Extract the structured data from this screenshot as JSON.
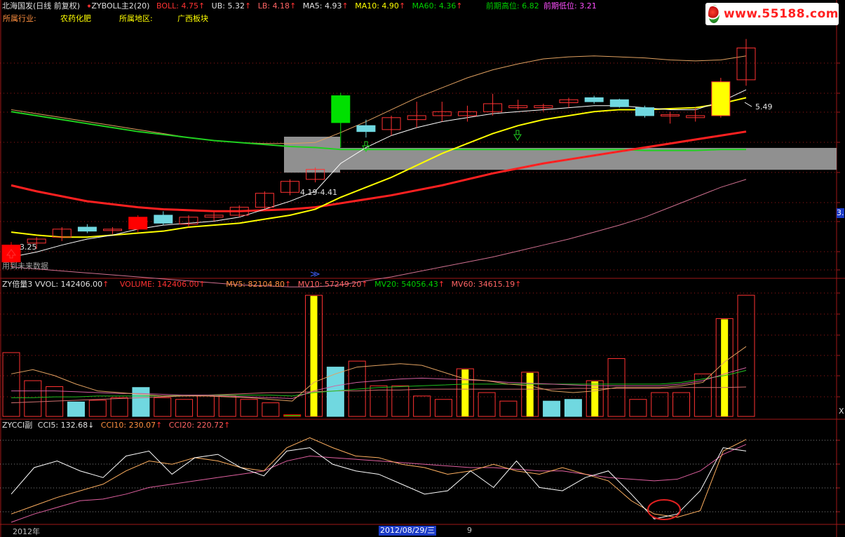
{
  "header": {
    "stock_name": "北海国发(日线 前复权)",
    "indicator": "ZYBOLL主2(20)",
    "boll": "BOLL: 4.75",
    "ub": "UB: 5.32",
    "lb": "LB: 4.18",
    "ma5": "MA5: 4.93",
    "ma10": "MA10: 4.90",
    "ma60": "MA60: 4.36",
    "prev_high": "前期高位: 6.82",
    "prev_low": "前期低位: 3.21",
    "industry_label": "所属行业:",
    "industry_value": "农药化肥",
    "region_label": "所属地区:",
    "region_value": "广西板块",
    "logo_text": "www.55188.com"
  },
  "price_panel": {
    "range_label": "4.19-4.41",
    "high_label": "5.49",
    "low_label": "3.25",
    "future_data_note": "用到未来数据",
    "right_tag": "3."
  },
  "volume_header": {
    "title": "ZY倍量3",
    "vvol": "VVOL: 142406.00",
    "volume": "VOLUME: 142406.00",
    "mv5": "MV5: 82104.80",
    "mv10": "MV10: 57249.20",
    "mv20": "MV20: 54056.43",
    "mv60": "MV60: 34615.19",
    "right_tag": "X"
  },
  "cci_header": {
    "title": "ZYCCI副",
    "cci5": "CCI5: 132.68",
    "cci10": "CCI10: 230.07",
    "cci20": "CCI20: 220.72"
  },
  "footer": {
    "year": "2012年",
    "date": "2012/08/29/三",
    "mark": "9"
  },
  "colors": {
    "up": "#ff3232",
    "down": "#70d8e0",
    "boll_band": "#e0a060",
    "ma5": "#ffffff",
    "ma10": "#ffff00",
    "ma60": "#ff2020",
    "ma_green": "#20d020",
    "grid": "#a01818"
  },
  "chart_data": [
    {
      "type": "candlestick",
      "title": "北海国发(日线 前复权)",
      "y_range": [
        3.1,
        5.6
      ],
      "candles": [
        {
          "o": 3.25,
          "h": 3.45,
          "l": 3.2,
          "c": 3.42,
          "color": "solid-red"
        },
        {
          "o": 3.44,
          "h": 3.5,
          "l": 3.38,
          "c": 3.48,
          "color": "up"
        },
        {
          "o": 3.5,
          "h": 3.6,
          "l": 3.46,
          "c": 3.58,
          "color": "up"
        },
        {
          "o": 3.6,
          "h": 3.63,
          "l": 3.54,
          "c": 3.56,
          "color": "down"
        },
        {
          "o": 3.57,
          "h": 3.6,
          "l": 3.53,
          "c": 3.58,
          "color": "up"
        },
        {
          "o": 3.58,
          "h": 3.72,
          "l": 3.55,
          "c": 3.7,
          "color": "solid-red"
        },
        {
          "o": 3.72,
          "h": 3.76,
          "l": 3.62,
          "c": 3.64,
          "color": "down"
        },
        {
          "o": 3.63,
          "h": 3.72,
          "l": 3.6,
          "c": 3.7,
          "color": "up"
        },
        {
          "o": 3.7,
          "h": 3.75,
          "l": 3.66,
          "c": 3.72,
          "color": "up"
        },
        {
          "o": 3.72,
          "h": 3.82,
          "l": 3.7,
          "c": 3.8,
          "color": "up"
        },
        {
          "o": 3.8,
          "h": 3.96,
          "l": 3.78,
          "c": 3.94,
          "color": "up"
        },
        {
          "o": 3.95,
          "h": 4.08,
          "l": 3.92,
          "c": 4.06,
          "color": "up"
        },
        {
          "o": 4.08,
          "h": 4.2,
          "l": 4.05,
          "c": 4.18,
          "color": "up"
        },
        {
          "o": 4.65,
          "h": 4.95,
          "l": 4.4,
          "c": 4.92,
          "color": "solid-green"
        },
        {
          "o": 4.62,
          "h": 4.68,
          "l": 4.5,
          "c": 4.56,
          "color": "down"
        },
        {
          "o": 4.58,
          "h": 4.72,
          "l": 4.52,
          "c": 4.7,
          "color": "up"
        },
        {
          "o": 4.68,
          "h": 4.86,
          "l": 4.6,
          "c": 4.72,
          "color": "up"
        },
        {
          "o": 4.72,
          "h": 4.86,
          "l": 4.66,
          "c": 4.76,
          "color": "up"
        },
        {
          "o": 4.72,
          "h": 4.82,
          "l": 4.66,
          "c": 4.76,
          "color": "up"
        },
        {
          "o": 4.76,
          "h": 4.94,
          "l": 4.72,
          "c": 4.84,
          "color": "up"
        },
        {
          "o": 4.82,
          "h": 4.88,
          "l": 4.78,
          "c": 4.8,
          "color": "up"
        },
        {
          "o": 4.8,
          "h": 4.84,
          "l": 4.76,
          "c": 4.82,
          "color": "up"
        },
        {
          "o": 4.85,
          "h": 4.9,
          "l": 4.8,
          "c": 4.88,
          "color": "up"
        },
        {
          "o": 4.9,
          "h": 4.92,
          "l": 4.84,
          "c": 4.86,
          "color": "down"
        },
        {
          "o": 4.88,
          "h": 4.89,
          "l": 4.8,
          "c": 4.81,
          "color": "down"
        },
        {
          "o": 4.8,
          "h": 4.82,
          "l": 4.7,
          "c": 4.72,
          "color": "down"
        },
        {
          "o": 4.72,
          "h": 4.76,
          "l": 4.64,
          "c": 4.73,
          "color": "up"
        },
        {
          "o": 4.7,
          "h": 4.8,
          "l": 4.66,
          "c": 4.72,
          "color": "up"
        },
        {
          "o": 4.72,
          "h": 5.1,
          "l": 4.7,
          "c": 5.06,
          "color": "solid-yellow"
        },
        {
          "o": 5.08,
          "h": 5.49,
          "l": 5.02,
          "c": 5.4,
          "color": "up"
        }
      ],
      "ma5": [
        3.3,
        3.35,
        3.42,
        3.48,
        3.52,
        3.58,
        3.62,
        3.64,
        3.66,
        3.7,
        3.78,
        3.86,
        3.96,
        4.24,
        4.4,
        4.52,
        4.6,
        4.66,
        4.7,
        4.74,
        4.76,
        4.78,
        4.8,
        4.82,
        4.82,
        4.8,
        4.78,
        4.78,
        4.86,
        4.98
      ],
      "ma10": [
        3.55,
        3.52,
        3.5,
        3.5,
        3.52,
        3.54,
        3.56,
        3.6,
        3.62,
        3.64,
        3.68,
        3.72,
        3.78,
        3.9,
        4.0,
        4.1,
        4.22,
        4.34,
        4.44,
        4.54,
        4.62,
        4.68,
        4.72,
        4.76,
        4.78,
        4.78,
        4.79,
        4.8,
        4.84,
        4.9
      ],
      "ma60": [
        4.02,
        3.96,
        3.91,
        3.86,
        3.83,
        3.8,
        3.78,
        3.77,
        3.76,
        3.76,
        3.77,
        3.78,
        3.8,
        3.84,
        3.88,
        3.92,
        3.97,
        4.02,
        4.08,
        4.14,
        4.19,
        4.24,
        4.28,
        4.32,
        4.36,
        4.4,
        4.44,
        4.48,
        4.52,
        4.56
      ],
      "ma_green": [
        4.76,
        4.72,
        4.68,
        4.64,
        4.6,
        4.56,
        4.53,
        4.5,
        4.47,
        4.45,
        4.43,
        4.41,
        4.4,
        4.38,
        4.38,
        4.38,
        4.38,
        4.38,
        4.38,
        4.38,
        4.38,
        4.38,
        4.38,
        4.38,
        4.38,
        4.37,
        4.37,
        4.37,
        4.38,
        4.38
      ],
      "ub": [
        4.78,
        4.74,
        4.7,
        4.66,
        4.62,
        4.58,
        4.54,
        4.5,
        4.47,
        4.45,
        4.44,
        4.44,
        4.45,
        4.55,
        4.66,
        4.78,
        4.9,
        5.0,
        5.1,
        5.18,
        5.24,
        5.29,
        5.31,
        5.32,
        5.31,
        5.3,
        5.28,
        5.27,
        5.28,
        5.32
      ],
      "lb": [
        3.2,
        3.18,
        3.16,
        3.14,
        3.12,
        3.1,
        3.08,
        3.06,
        3.04,
        3.02,
        3.01,
        3.0,
        3.0,
        3.02,
        3.06,
        3.1,
        3.15,
        3.2,
        3.25,
        3.3,
        3.36,
        3.42,
        3.48,
        3.55,
        3.62,
        3.7,
        3.8,
        3.9,
        4.0,
        4.08
      ]
    },
    {
      "type": "bar",
      "title": "ZY倍量3",
      "y_range": [
        0,
        145000
      ],
      "values": [
        75000,
        42000,
        35000,
        17000,
        19000,
        22000,
        34000,
        22000,
        20000,
        24000,
        24000,
        20000,
        16000,
        2000,
        142406,
        58000,
        65000,
        36000,
        36000,
        24000,
        20000,
        56000,
        28000,
        18000,
        52000,
        18000,
        20000,
        42000,
        68000,
        20000,
        28000,
        28000,
        50000,
        115000,
        142406
      ],
      "colors": [
        "up",
        "up",
        "up",
        "down",
        "up",
        "up",
        "down",
        "up",
        "up",
        "up",
        "up",
        "up",
        "up",
        "solid-green",
        "yellow",
        "down",
        "up",
        "up",
        "up",
        "up",
        "up",
        "yellow",
        "up",
        "up",
        "yellow",
        "down",
        "down",
        "yellow",
        "up",
        "up",
        "up",
        "up",
        "up",
        "yellow",
        "up"
      ],
      "mv5": [
        50000,
        55000,
        48000,
        38000,
        30000,
        28000,
        26000,
        24000,
        24000,
        24000,
        23000,
        22000,
        20000,
        18000,
        40000,
        50000,
        58000,
        60000,
        62000,
        60000,
        52000,
        44000,
        42000,
        38000,
        36000,
        30000,
        28000,
        30000,
        34000,
        34000,
        34000,
        36000,
        40000,
        64000,
        82104
      ],
      "mv10": [
        30000,
        30000,
        30000,
        29000,
        28000,
        27000,
        27000,
        26000,
        25000,
        25000,
        24000,
        23000,
        22000,
        21000,
        30000,
        36000,
        40000,
        42000,
        44000,
        45000,
        44000,
        43000,
        42000,
        40000,
        39000,
        38000,
        37000,
        36000,
        36000,
        36000,
        36000,
        38000,
        42000,
        50000,
        57249
      ],
      "mv20": [
        22000,
        22000,
        23000,
        23000,
        24000,
        24000,
        24000,
        24000,
        25000,
        25000,
        25000,
        25000,
        25000,
        24000,
        28000,
        30000,
        32000,
        34000,
        35000,
        36000,
        37000,
        38000,
        38000,
        38000,
        38000,
        38000,
        38000,
        38000,
        38000,
        38000,
        38000,
        40000,
        44000,
        48000,
        54056
      ],
      "mv60": [
        16000,
        17000,
        18000,
        19000,
        20000,
        21000,
        22000,
        23000,
        24000,
        25000,
        26000,
        27000,
        28000,
        28000,
        29000,
        30000,
        30000,
        31000,
        31000,
        32000,
        32000,
        32000,
        32000,
        32000,
        32000,
        32000,
        33000,
        33000,
        33000,
        33000,
        33000,
        34000,
        34000,
        34000,
        34615
      ]
    },
    {
      "type": "line",
      "title": "ZYCCI副",
      "y_range": [
        -250,
        300
      ],
      "cci5": [
        -80,
        80,
        120,
        60,
        20,
        150,
        180,
        40,
        140,
        160,
        80,
        30,
        180,
        200,
        100,
        60,
        40,
        -20,
        -80,
        -60,
        60,
        -40,
        120,
        -40,
        -60,
        20,
        60,
        -80,
        -230,
        -200,
        -60,
        200,
        180
      ],
      "cci10": [
        -200,
        -150,
        -100,
        -60,
        -20,
        60,
        120,
        100,
        140,
        120,
        80,
        60,
        200,
        260,
        200,
        150,
        140,
        100,
        80,
        40,
        60,
        100,
        60,
        40,
        80,
        40,
        0,
        -120,
        -200,
        -220,
        -180,
        180,
        250
      ],
      "cci20": [
        -250,
        -200,
        -160,
        -120,
        -110,
        -80,
        -40,
        -20,
        0,
        20,
        40,
        60,
        120,
        150,
        140,
        130,
        120,
        110,
        100,
        90,
        80,
        80,
        70,
        60,
        60,
        40,
        20,
        10,
        0,
        10,
        60,
        160,
        220
      ]
    }
  ]
}
